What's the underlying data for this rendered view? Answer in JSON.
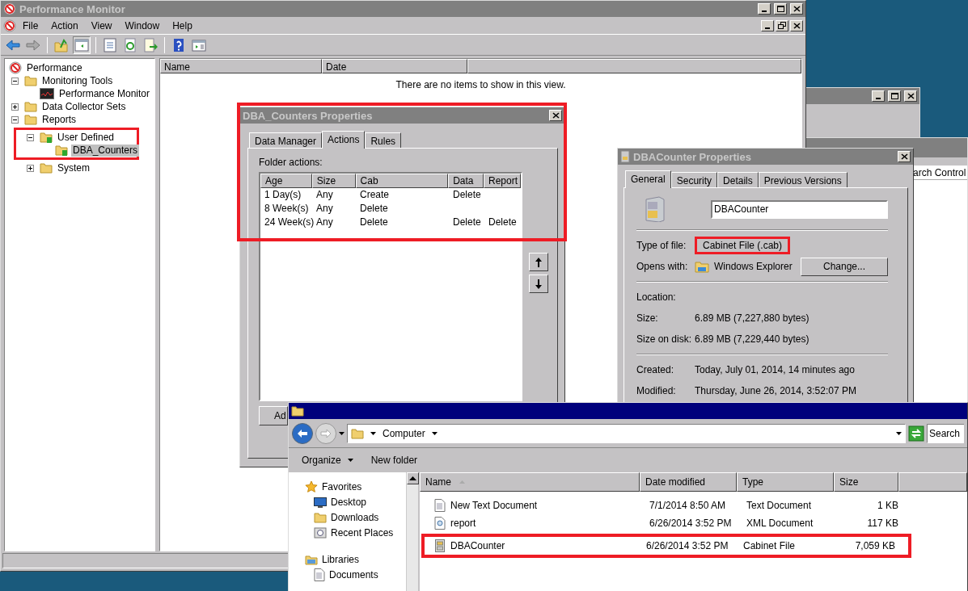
{
  "perf_monitor": {
    "title": "Performance Monitor",
    "active": false,
    "menu": [
      "File",
      "Action",
      "View",
      "Window",
      "Help"
    ],
    "tree": [
      {
        "label": "Performance",
        "kind": "root",
        "selected": false,
        "children": [
          {
            "label": "Monitoring Tools",
            "kind": "folder",
            "expanded": true,
            "selected": false,
            "children": [
              {
                "label": "Performance Monitor",
                "kind": "monitor",
                "selected": false
              }
            ]
          },
          {
            "label": "Data Collector Sets",
            "kind": "folder",
            "expanded": false,
            "selected": false
          },
          {
            "label": "Reports",
            "kind": "folder",
            "expanded": true,
            "selected": false,
            "children": [
              {
                "label": "User Defined",
                "kind": "folder",
                "expanded": true,
                "selected": false,
                "highlighted": true,
                "children": [
                  {
                    "label": "DBA_Counters",
                    "kind": "folder",
                    "selected": true
                  }
                ]
              },
              {
                "label": "System",
                "kind": "folder",
                "expanded": false,
                "selected": false
              }
            ]
          }
        ]
      }
    ],
    "columns": [
      "Name",
      "Date"
    ],
    "empty_message": "There are no items to show in this view."
  },
  "dba_dialog": {
    "title": "DBA_Counters Properties",
    "active": false,
    "highlighted": true,
    "tabs": [
      {
        "label": "Data Manager",
        "selected": false
      },
      {
        "label": "Actions",
        "selected": true
      },
      {
        "label": "Rules",
        "selected": false
      }
    ],
    "folder_actions_label": "Folder actions:",
    "columns": [
      "Age",
      "Size",
      "Cab",
      "Data",
      "Report"
    ],
    "rows": [
      {
        "age": "1 Day(s)",
        "size": "Any",
        "cab": "Create",
        "data": "Delete"
      },
      {
        "age": "8 Week(s)",
        "size": "Any",
        "cab": "Delete"
      },
      {
        "age": "24 Week(s)",
        "size": "Any",
        "cab": "Delete",
        "data": "Delete",
        "report": "Delete"
      }
    ],
    "add_button": "Ad"
  },
  "background_window": {
    "search_text": "arch Control"
  },
  "props_dialog": {
    "title": "DBACounter Properties",
    "active": false,
    "tabs": [
      {
        "label": "General",
        "selected": true
      },
      {
        "label": "Security",
        "selected": false
      },
      {
        "label": "Details",
        "selected": false
      },
      {
        "label": "Previous Versions",
        "selected": false
      }
    ],
    "name_value": "DBACounter",
    "sections": [
      [
        {
          "label": "Type of file:",
          "value": "Cabinet File (.cab)",
          "highlighted": true
        },
        {
          "label": "Opens with:",
          "value": "Windows Explorer",
          "kind": "app",
          "button": "Change..."
        }
      ],
      [
        {
          "label": "Location:"
        },
        {
          "label": "Size:",
          "value": "6.89 MB (7,227,880 bytes)"
        },
        {
          "label": "Size on disk:",
          "value": "6.89 MB (7,229,440 bytes)"
        }
      ],
      [
        {
          "label": "Created:",
          "value": "Today, July 01, 2014, 14 minutes ago"
        },
        {
          "label": "Modified:",
          "value": "Thursday, June 26, 2014, 3:52:07 PM"
        }
      ]
    ]
  },
  "explorer": {
    "active": true,
    "address": "Computer",
    "search_placeholder": "Search",
    "commands": [
      "Organize",
      "New folder"
    ],
    "nav": [
      {
        "label": "Favorites",
        "kind": "favorites",
        "items": [
          {
            "label": "Desktop",
            "kind": "desktop"
          },
          {
            "label": "Downloads",
            "kind": "folder"
          },
          {
            "label": "Recent Places",
            "kind": "recent"
          }
        ]
      },
      {
        "label": "Libraries",
        "kind": "libraries",
        "items": [
          {
            "label": "Documents",
            "kind": "document"
          }
        ]
      }
    ],
    "columns": [
      "Name",
      "Date modified",
      "Type",
      "Size"
    ],
    "files": [
      {
        "name": "New Text Document",
        "date": "7/1/2014 8:50 AM",
        "type": "Text Document",
        "size": "1 KB",
        "kind": "text"
      },
      {
        "name": "report",
        "date": "6/26/2014 3:52 PM",
        "type": "XML Document",
        "size": "117 KB",
        "kind": "xml"
      },
      {
        "name": "DBACounter",
        "date": "6/26/2014 3:52 PM",
        "type": "Cabinet File",
        "size": "7,059 KB",
        "kind": "cab",
        "highlighted": true
      }
    ]
  }
}
